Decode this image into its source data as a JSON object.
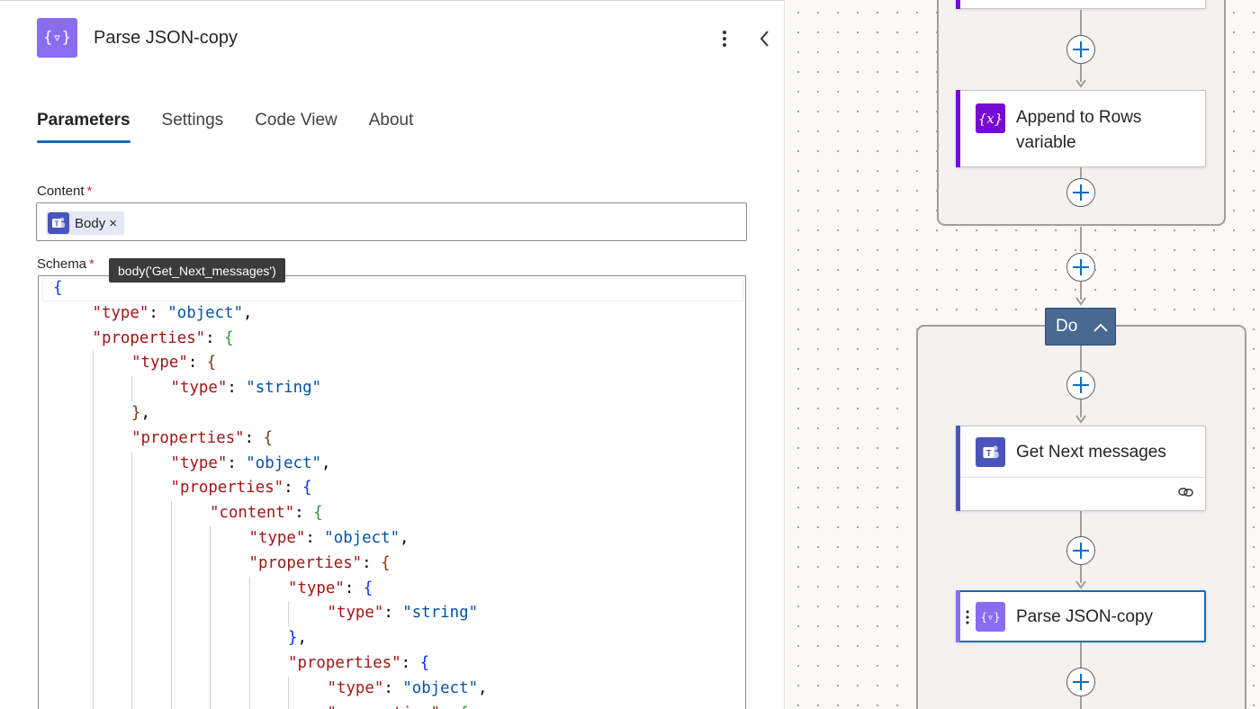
{
  "panel": {
    "title": "Parse JSON-copy",
    "tabs": [
      {
        "label": "Parameters",
        "active": true
      },
      {
        "label": "Settings",
        "active": false
      },
      {
        "label": "Code View",
        "active": false
      },
      {
        "label": "About",
        "active": false
      }
    ],
    "content_field": {
      "label": "Content",
      "required_mark": "*",
      "token": {
        "label": "Body",
        "remove": "×",
        "icon": "teams-icon"
      }
    },
    "schema_field": {
      "label": "Schema",
      "required_mark": "*",
      "tooltip": "body('Get_Next_messages')",
      "code_lines": [
        {
          "indent": 0,
          "tokens": [
            {
              "t": "{",
              "c": "b1"
            }
          ]
        },
        {
          "indent": 1,
          "tokens": [
            {
              "t": "\"type\"",
              "c": "k"
            },
            {
              "t": ": ",
              "c": ""
            },
            {
              "t": "\"object\"",
              "c": "s"
            },
            {
              "t": ",",
              "c": ""
            }
          ]
        },
        {
          "indent": 1,
          "tokens": [
            {
              "t": "\"properties\"",
              "c": "k"
            },
            {
              "t": ": ",
              "c": ""
            },
            {
              "t": "{",
              "c": "b2"
            }
          ]
        },
        {
          "indent": 2,
          "tokens": [
            {
              "t": "\"type\"",
              "c": "k"
            },
            {
              "t": ": ",
              "c": ""
            },
            {
              "t": "{",
              "c": "b3"
            }
          ]
        },
        {
          "indent": 3,
          "tokens": [
            {
              "t": "\"type\"",
              "c": "k"
            },
            {
              "t": ": ",
              "c": ""
            },
            {
              "t": "\"string\"",
              "c": "s"
            }
          ]
        },
        {
          "indent": 2,
          "tokens": [
            {
              "t": "}",
              "c": "b3"
            },
            {
              "t": ",",
              "c": ""
            }
          ]
        },
        {
          "indent": 2,
          "tokens": [
            {
              "t": "\"properties\"",
              "c": "k"
            },
            {
              "t": ": ",
              "c": ""
            },
            {
              "t": "{",
              "c": "b3"
            }
          ]
        },
        {
          "indent": 3,
          "tokens": [
            {
              "t": "\"type\"",
              "c": "k"
            },
            {
              "t": ": ",
              "c": ""
            },
            {
              "t": "\"object\"",
              "c": "s"
            },
            {
              "t": ",",
              "c": ""
            }
          ]
        },
        {
          "indent": 3,
          "tokens": [
            {
              "t": "\"properties\"",
              "c": "k"
            },
            {
              "t": ": ",
              "c": ""
            },
            {
              "t": "{",
              "c": "b1"
            }
          ]
        },
        {
          "indent": 4,
          "tokens": [
            {
              "t": "\"content\"",
              "c": "k"
            },
            {
              "t": ": ",
              "c": ""
            },
            {
              "t": "{",
              "c": "b2"
            }
          ]
        },
        {
          "indent": 5,
          "tokens": [
            {
              "t": "\"type\"",
              "c": "k"
            },
            {
              "t": ": ",
              "c": ""
            },
            {
              "t": "\"object\"",
              "c": "s"
            },
            {
              "t": ",",
              "c": ""
            }
          ]
        },
        {
          "indent": 5,
          "tokens": [
            {
              "t": "\"properties\"",
              "c": "k"
            },
            {
              "t": ": ",
              "c": ""
            },
            {
              "t": "{",
              "c": "b3"
            }
          ]
        },
        {
          "indent": 6,
          "tokens": [
            {
              "t": "\"type\"",
              "c": "k"
            },
            {
              "t": ": ",
              "c": ""
            },
            {
              "t": "{",
              "c": "b1"
            }
          ]
        },
        {
          "indent": 7,
          "tokens": [
            {
              "t": "\"type\"",
              "c": "k"
            },
            {
              "t": ": ",
              "c": ""
            },
            {
              "t": "\"string\"",
              "c": "s"
            }
          ]
        },
        {
          "indent": 6,
          "tokens": [
            {
              "t": "}",
              "c": "b1"
            },
            {
              "t": ",",
              "c": ""
            }
          ]
        },
        {
          "indent": 6,
          "tokens": [
            {
              "t": "\"properties\"",
              "c": "k"
            },
            {
              "t": ": ",
              "c": ""
            },
            {
              "t": "{",
              "c": "b1"
            }
          ]
        },
        {
          "indent": 7,
          "tokens": [
            {
              "t": "\"type\"",
              "c": "k"
            },
            {
              "t": ": ",
              "c": ""
            },
            {
              "t": "\"object\"",
              "c": "s"
            },
            {
              "t": ",",
              "c": ""
            }
          ]
        },
        {
          "indent": 7,
          "tokens": [
            {
              "t": "\"properties\"",
              "c": "k"
            },
            {
              "t": ": ",
              "c": ""
            },
            {
              "t": "{",
              "c": "b2"
            }
          ]
        }
      ]
    }
  },
  "flow": {
    "cards": {
      "append": {
        "title_line1": "Append to Rows",
        "title_line2": "variable",
        "icon": "variable-icon",
        "icon_text": "{x}",
        "accent": "#770bd6"
      },
      "get_next": {
        "title": "Get Next messages",
        "icon": "teams-icon",
        "accent": "#4b53bc",
        "link_icon": "link-icon"
      },
      "parse": {
        "title": "Parse JSON-copy",
        "icon": "parse-json-icon",
        "icon_text": "{▿}",
        "accent": "#8a6cf0"
      }
    },
    "do_scope": {
      "label": "Do",
      "chevron": "chevron-up-icon"
    }
  },
  "colors": {
    "selected_border": "#0f6cbd",
    "tab_underline": "#0f6cbd",
    "do_header": "#486991"
  }
}
